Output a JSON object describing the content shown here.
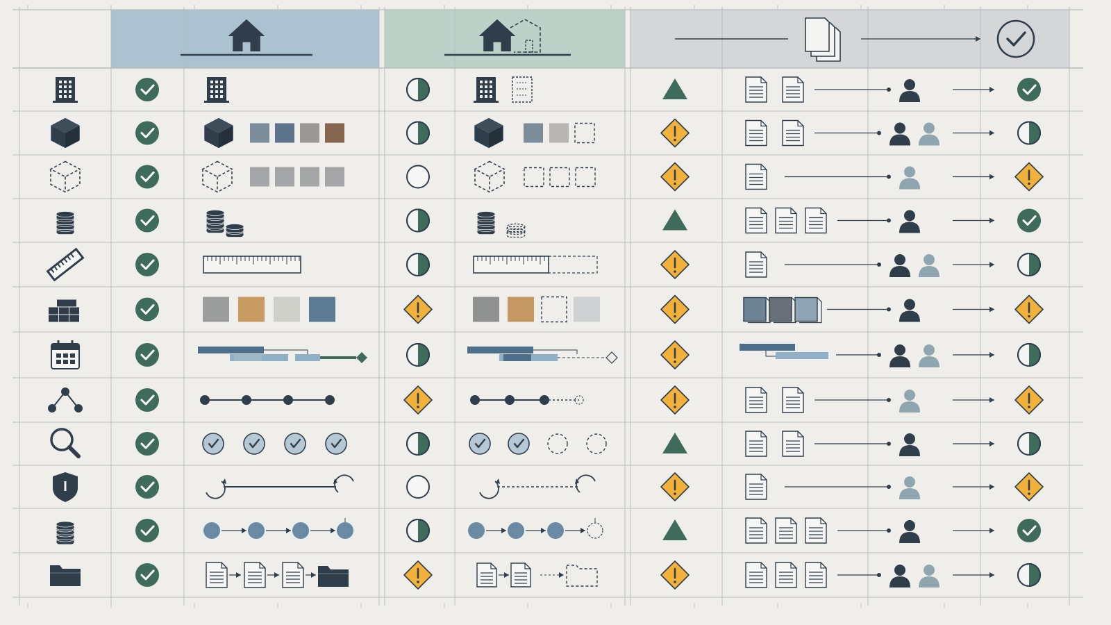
{
  "colors": {
    "background": "#efeeea",
    "grid": "#b9bcbd",
    "dark": "#2f3e4a",
    "green_ok": "#3e6b5c",
    "warning": "#f2b13b",
    "blue_mid": "#4d6f8c",
    "blue_light": "#8fb0c6",
    "person_light": "#8fa6b0",
    "header_blue": "#adc2d1",
    "header_green": "#bcd2c9",
    "header_grey": "#d4d6d7"
  },
  "header": {
    "col1_icon": "house-icon",
    "col2_icon": "house-with-dashed-extension-icon",
    "col3_icons": [
      "documents-stack-icon",
      "check-circle-icon"
    ]
  },
  "rows": [
    {
      "category_icon": "building-icon",
      "col1_status": "ok",
      "col1_detail": "building",
      "col2_status": "half",
      "col2_detail": "building-partial",
      "col3_status": "triangle",
      "col3_docs": 2,
      "col3_people": [
        "dark"
      ],
      "col3_result": "ok"
    },
    {
      "category_icon": "cube-icon",
      "col1_status": "ok",
      "col1_detail": "cube-materials",
      "col2_status": "half",
      "col2_detail": "cube-materials-partial",
      "col3_status": "warning",
      "col3_docs": 2,
      "col3_people": [
        "dark",
        "light"
      ],
      "col3_result": "half"
    },
    {
      "category_icon": "dashed-cube-icon",
      "col1_status": "ok",
      "col1_detail": "dashed-cube-grey",
      "col2_status": "empty",
      "col2_detail": "dashed-cube-empty",
      "col3_status": "warning",
      "col3_docs": 1,
      "col3_people": [
        "light"
      ],
      "col3_result": "warning"
    },
    {
      "category_icon": "coins-stack-icon",
      "col1_status": "ok",
      "col1_detail": "coins-full",
      "col2_status": "half",
      "col2_detail": "coins-partial",
      "col3_status": "triangle",
      "col3_docs": 3,
      "col3_people": [
        "dark"
      ],
      "col3_result": "ok"
    },
    {
      "category_icon": "ruler-icon",
      "col1_status": "ok",
      "col1_detail": "ruler-full",
      "col2_status": "half",
      "col2_detail": "ruler-partial",
      "col3_status": "warning",
      "col3_docs": 1,
      "col3_people": [
        "dark",
        "light"
      ],
      "col3_result": "half"
    },
    {
      "category_icon": "bricks-icon",
      "col1_status": "ok",
      "col1_detail": "material-swatches",
      "col2_status": "warning",
      "col2_detail": "material-swatches-partial",
      "col3_status": "warning",
      "col3_docs": 3,
      "col3_people": [
        "dark"
      ],
      "col3_result": "warning"
    },
    {
      "category_icon": "calendar-icon",
      "col1_status": "ok",
      "col1_detail": "gantt-full",
      "col2_status": "half",
      "col2_detail": "gantt-partial",
      "col3_status": "warning",
      "col3_docs": 0,
      "col3_people": [
        "dark",
        "light"
      ],
      "col3_result": "half"
    },
    {
      "category_icon": "network-nodes-icon",
      "col1_status": "ok",
      "col1_detail": "timeline-full",
      "col2_status": "warning",
      "col2_detail": "timeline-partial",
      "col3_status": "warning",
      "col3_docs": 2,
      "col3_people": [
        "light"
      ],
      "col3_result": "warning"
    },
    {
      "category_icon": "magnifier-icon",
      "col1_status": "ok",
      "col1_detail": "checks-four",
      "col2_status": "half",
      "col2_detail": "checks-two",
      "col3_status": "triangle",
      "col3_docs": 2,
      "col3_people": [
        "dark"
      ],
      "col3_result": "half"
    },
    {
      "category_icon": "shield-icon",
      "col1_status": "ok",
      "col1_detail": "cycle-full",
      "col2_status": "empty",
      "col2_detail": "cycle-dashed",
      "col3_status": "warning",
      "col3_docs": 1,
      "col3_people": [
        "light"
      ],
      "col3_result": "warning"
    },
    {
      "category_icon": "coins-stack-icon",
      "col1_status": "ok",
      "col1_detail": "flow-full",
      "col2_status": "half",
      "col2_detail": "flow-partial",
      "col3_status": "triangle",
      "col3_docs": 3,
      "col3_people": [
        "dark"
      ],
      "col3_result": "ok"
    },
    {
      "category_icon": "folder-icon",
      "col1_status": "ok",
      "col1_detail": "docs-to-folder",
      "col2_status": "warning",
      "col2_detail": "docs-to-folder-partial",
      "col3_status": "warning",
      "col3_docs": 3,
      "col3_people": [
        "dark",
        "light"
      ],
      "col3_result": "half"
    }
  ]
}
